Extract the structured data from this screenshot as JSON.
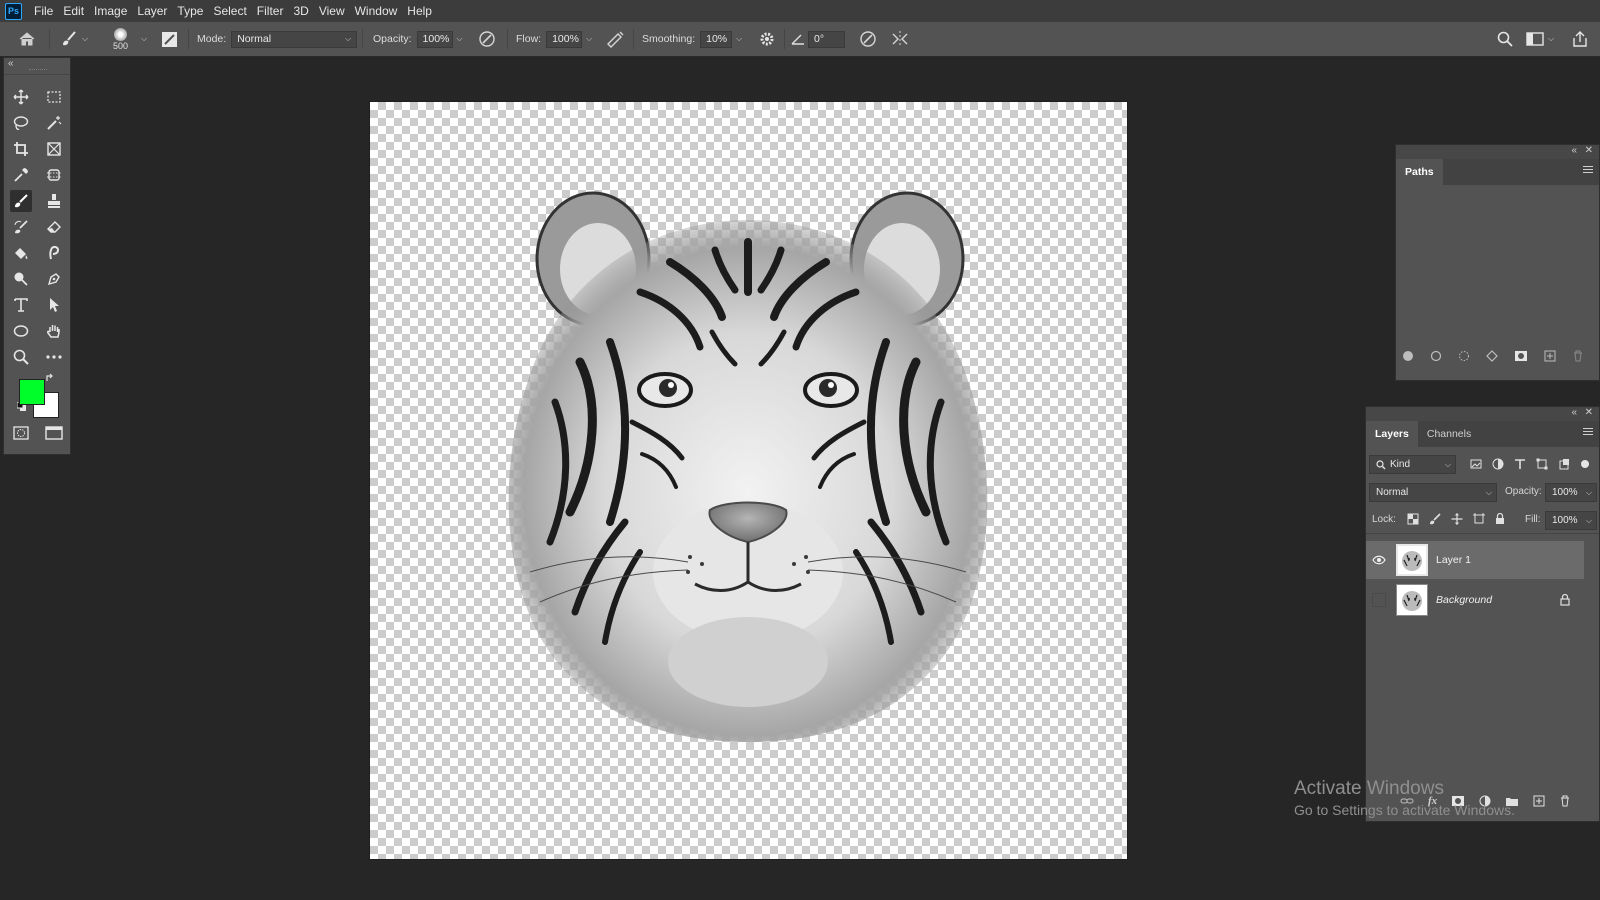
{
  "app": {
    "logo": "Ps"
  },
  "menu": [
    "File",
    "Edit",
    "Image",
    "Layer",
    "Type",
    "Select",
    "Filter",
    "3D",
    "View",
    "Window",
    "Help"
  ],
  "options_bar": {
    "brush_size": "500",
    "mode_label": "Mode:",
    "mode_value": "Normal",
    "opacity_label": "Opacity:",
    "opacity_value": "100%",
    "flow_label": "Flow:",
    "flow_value": "100%",
    "smoothing_label": "Smoothing:",
    "smoothing_value": "10%",
    "angle_value": "0°"
  },
  "tools": {
    "foreground_color": "#00ff2a",
    "background_color": "#ffffff",
    "active_tool": "brush-tool"
  },
  "canvas": {
    "content": "tiger-illustration",
    "background": "transparent"
  },
  "paths_panel": {
    "tab": "Paths"
  },
  "layers_panel": {
    "tabs": [
      "Layers",
      "Channels"
    ],
    "filter_value": "Kind",
    "blend_mode": "Normal",
    "opacity_label": "Opacity:",
    "opacity_value": "100%",
    "lock_label": "Lock:",
    "fill_label": "Fill:",
    "fill_value": "100%",
    "layers": [
      {
        "name": "Layer 1",
        "visible": true,
        "selected": true
      },
      {
        "name": "Background",
        "visible": false,
        "locked": true
      }
    ]
  },
  "watermark": {
    "title": "Activate Windows",
    "subtitle": "Go to Settings to activate Windows."
  }
}
